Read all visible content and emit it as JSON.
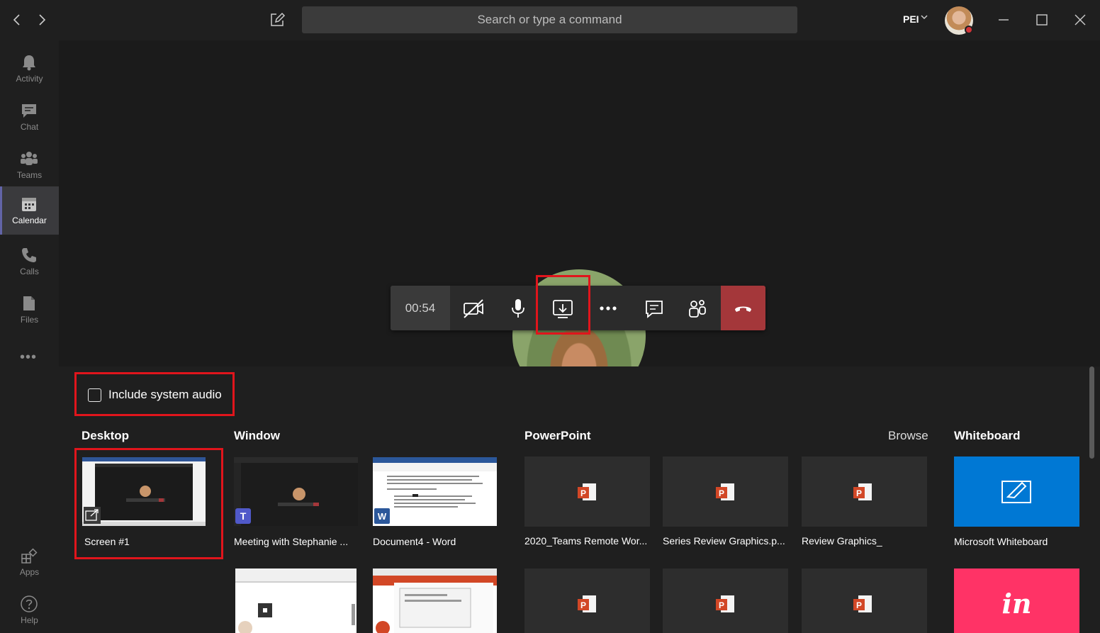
{
  "topbar": {
    "search_placeholder": "Search or type a command",
    "tenant": "PEI"
  },
  "rail": {
    "items": [
      {
        "label": "Activity"
      },
      {
        "label": "Chat"
      },
      {
        "label": "Teams"
      },
      {
        "label": "Calendar"
      },
      {
        "label": "Calls"
      },
      {
        "label": "Files"
      }
    ],
    "more": "•••",
    "apps": "Apps",
    "help": "Help"
  },
  "meeting": {
    "timer": "00:54"
  },
  "share": {
    "include_audio": "Include system audio",
    "desktop_heading": "Desktop",
    "window_heading": "Window",
    "powerpoint_heading": "PowerPoint",
    "browse": "Browse",
    "whiteboard_heading": "Whiteboard",
    "desktop": [
      {
        "label": "Screen #1"
      }
    ],
    "windows": [
      {
        "label": "Meeting with Stephanie ..."
      },
      {
        "label": "Document4 - Word"
      }
    ],
    "powerpoint": [
      {
        "label": "2020_Teams Remote Wor..."
      },
      {
        "label": "Series Review Graphics.p..."
      },
      {
        "label": "Review Graphics_"
      }
    ],
    "whiteboards": [
      {
        "label": "Microsoft Whiteboard"
      }
    ],
    "invision_logo": "in"
  },
  "colors": {
    "highlight": "#e0151c",
    "hangup": "#a4373a",
    "whiteboard": "#0078d4",
    "invision": "#ff3366",
    "ppt": "#d24726"
  }
}
